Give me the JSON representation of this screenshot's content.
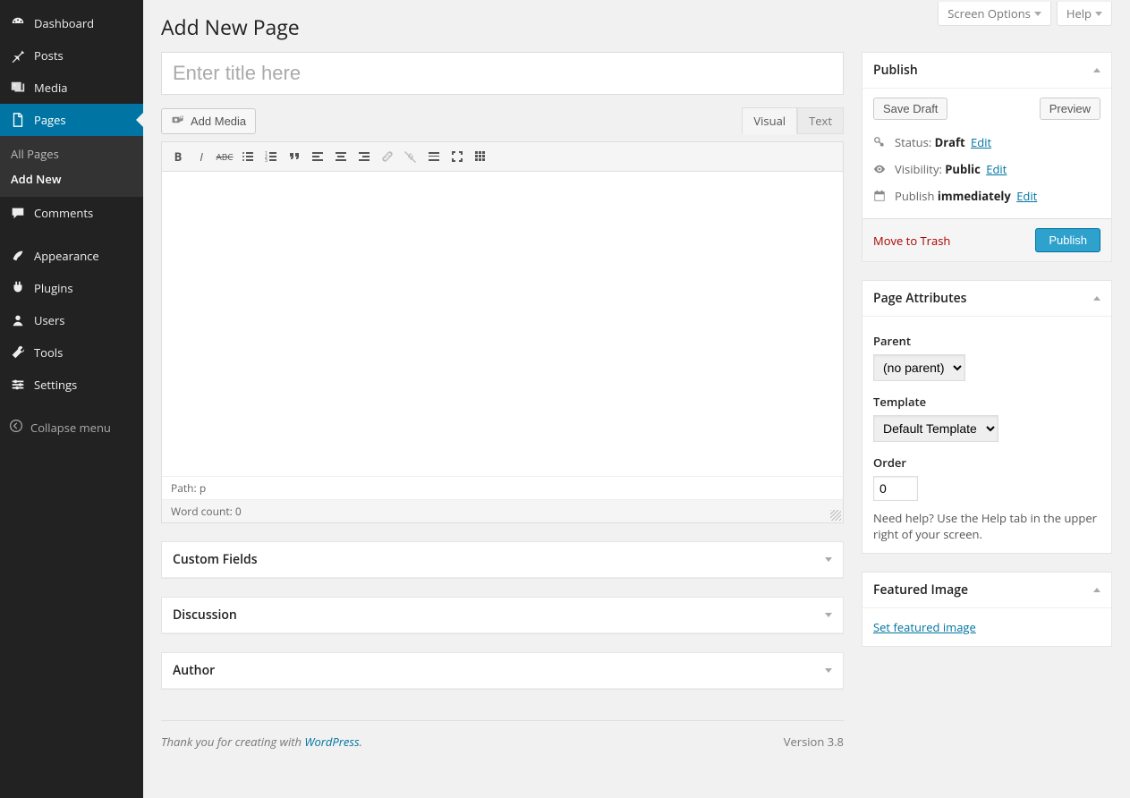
{
  "topTabs": {
    "screenOptions": "Screen Options",
    "help": "Help"
  },
  "heading": "Add New Page",
  "titlePlaceholder": "Enter title here",
  "sidebar": {
    "items": [
      {
        "label": "Dashboard"
      },
      {
        "label": "Posts"
      },
      {
        "label": "Media"
      },
      {
        "label": "Pages"
      },
      {
        "label": "Comments"
      },
      {
        "label": "Appearance"
      },
      {
        "label": "Plugins"
      },
      {
        "label": "Users"
      },
      {
        "label": "Tools"
      },
      {
        "label": "Settings"
      }
    ],
    "submenu": {
      "allPages": "All Pages",
      "addNew": "Add New"
    },
    "collapse": "Collapse menu"
  },
  "editor": {
    "addMedia": "Add Media",
    "tabVisual": "Visual",
    "tabText": "Text",
    "pathLabel": "Path:",
    "pathValue": "p",
    "wordCountLabel": "Word count:",
    "wordCountValue": "0"
  },
  "metaboxes": {
    "customFields": "Custom Fields",
    "discussion": "Discussion",
    "author": "Author"
  },
  "publish": {
    "title": "Publish",
    "saveDraft": "Save Draft",
    "preview": "Preview",
    "statusLabel": "Status:",
    "statusValue": "Draft",
    "visibilityLabel": "Visibility:",
    "visibilityValue": "Public",
    "publishLabel": "Publish",
    "publishValue": "immediately",
    "edit": "Edit",
    "trash": "Move to Trash",
    "publishBtn": "Publish"
  },
  "attributes": {
    "title": "Page Attributes",
    "parentLabel": "Parent",
    "parentValue": "(no parent)",
    "templateLabel": "Template",
    "templateValue": "Default Template",
    "orderLabel": "Order",
    "orderValue": "0",
    "help": "Need help? Use the Help tab in the upper right of your screen."
  },
  "featured": {
    "title": "Featured Image",
    "link": "Set featured image"
  },
  "footer": {
    "thank": "Thank you for creating with ",
    "wp": "WordPress",
    "dot": ".",
    "version": "Version 3.8"
  }
}
